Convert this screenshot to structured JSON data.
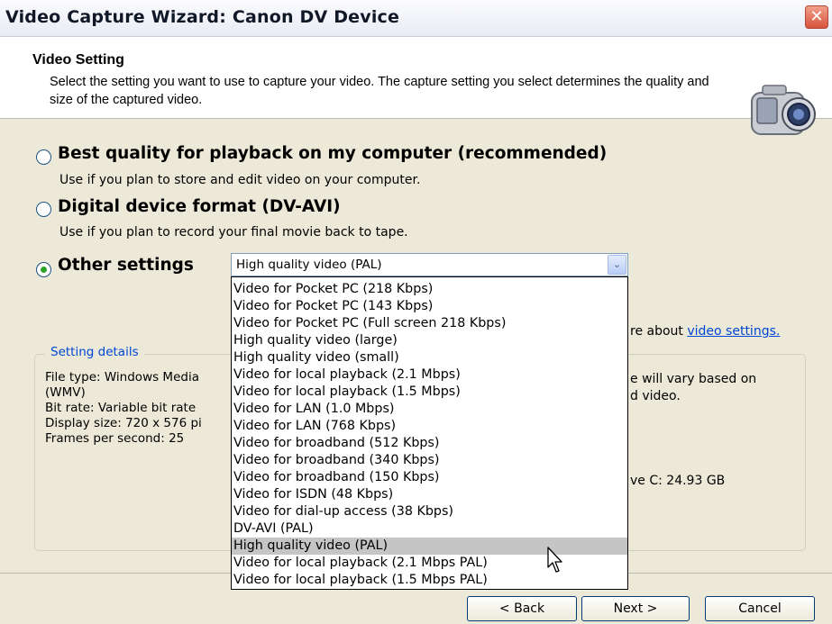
{
  "window": {
    "title": "Video Capture Wizard: Canon DV Device",
    "close_glyph": "✕"
  },
  "header": {
    "title": "Video Setting",
    "description": "Select the setting you want to use to capture your video. The capture setting you select determines the quality and size of the captured video.",
    "icon": "camcorder-icon"
  },
  "options": [
    {
      "label": "Best quality for playback on my computer (recommended)",
      "description": "Use if you plan to store and edit video on your computer.",
      "selected": false
    },
    {
      "label": "Digital device format (DV-AVI)",
      "description": "Use if you plan to record your final movie back to tape.",
      "selected": false
    },
    {
      "label": "Other settings",
      "selected": true
    }
  ],
  "combo": {
    "value": "High quality video (PAL)",
    "arrow_glyph": "⌄"
  },
  "dropdown": {
    "items": [
      "Video for Pocket PC (218 Kbps)",
      "Video for Pocket PC (143 Kbps)",
      "Video for Pocket PC (Full screen 218 Kbps)",
      "High quality video (large)",
      "High quality video (small)",
      "Video for local playback (2.1 Mbps)",
      "Video for local playback (1.5 Mbps)",
      "Video for LAN (1.0 Mbps)",
      "Video for LAN (768 Kbps)",
      "Video for broadband (512 Kbps)",
      "Video for broadband (340 Kbps)",
      "Video for broadband (150 Kbps)",
      "Video for ISDN (48 Kbps)",
      "Video for dial-up access (38 Kbps)",
      "DV-AVI (PAL)",
      "High quality video (PAL)",
      "Video for local playback (2.1 Mbps PAL)",
      "Video for local playback (1.5 Mbps PAL)"
    ],
    "selected_index": 15
  },
  "learn_more": {
    "prefix": "re about ",
    "link": "video settings."
  },
  "details": {
    "legend": "Setting details",
    "lines": [
      "File type: Windows Media",
      "(WMV)",
      "Bit rate: Variable bit rate",
      "Display size: 720 x 576 pi",
      "Frames per second: 25"
    ],
    "right_line1": "e will vary based on",
    "right_line2": "d video.",
    "disk_space": "ve C: 24.93 GB"
  },
  "buttons": {
    "back": "< Back",
    "next": "Next >",
    "cancel": "Cancel"
  },
  "colors": {
    "accent": "#0046d5",
    "radio_dot": "#2aa52a",
    "selection": "#c5c5c5",
    "close": "#d9523a"
  }
}
